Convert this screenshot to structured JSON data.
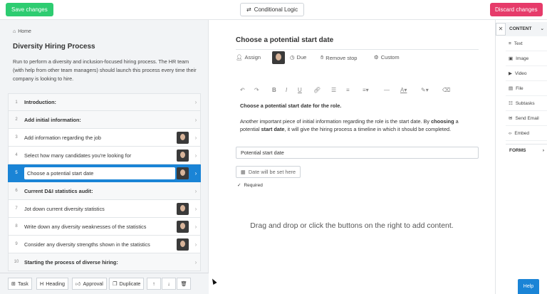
{
  "topbar": {
    "save_label": "Save changes",
    "logic_label": "Conditional Logic",
    "discard_label": "Discard changes"
  },
  "left": {
    "breadcrumb": "Home",
    "title": "Diversity Hiring Process",
    "description": "Run to perform a diversity and inclusion-focused hiring process. The HR team (with help from other team managers) should launch this process every time their company is looking to hire.",
    "items": [
      {
        "num": "1",
        "label": "Introduction:",
        "type": "heading"
      },
      {
        "num": "2",
        "label": "Add initial information:",
        "type": "heading"
      },
      {
        "num": "3",
        "label": "Add information regarding the job",
        "type": "task"
      },
      {
        "num": "4",
        "label": "Select how many candidates you're looking for",
        "type": "task"
      },
      {
        "num": "5",
        "label": "Choose a potential start date",
        "type": "selected"
      },
      {
        "num": "6",
        "label": "Current D&I statistics audit:",
        "type": "heading"
      },
      {
        "num": "7",
        "label": "Jot down current diversity statistics",
        "type": "task"
      },
      {
        "num": "8",
        "label": "Write down any diversity weaknesses of the statistics",
        "type": "task"
      },
      {
        "num": "9",
        "label": "Consider any diversity strengths shown in the statistics",
        "type": "task"
      },
      {
        "num": "10",
        "label": "Starting the process of diverse hiring:",
        "type": "heading"
      }
    ],
    "bottom": {
      "task": "Task",
      "heading": "Heading",
      "approval": "Approval",
      "duplicate": "Duplicate"
    }
  },
  "center": {
    "title": "Choose a potential start date",
    "controls": {
      "assign": "Assign",
      "due": "Due",
      "remove_stop": "Remove stop",
      "custom": "Custom"
    },
    "text_bold": "Choose a potential start date for the role.",
    "text_body_1": "Another important piece of initial information regarding the role is the start date. By ",
    "text_body_b1": "choosing",
    "text_body_2": " a potential ",
    "text_body_b2": "start date",
    "text_body_3": ", it will give the hiring process a timeline in which it should be completed.",
    "field_value": "Potential start date",
    "date_button": "Date will be set here",
    "required": "Required",
    "drop_text": "Drag and drop or click the buttons on the right to add content."
  },
  "right": {
    "content_label": "CONTENT",
    "items": [
      "Text",
      "Image",
      "Video",
      "File",
      "Subtasks",
      "Send Email",
      "Embed"
    ],
    "forms_label": "FORMS"
  },
  "help_label": "Help"
}
